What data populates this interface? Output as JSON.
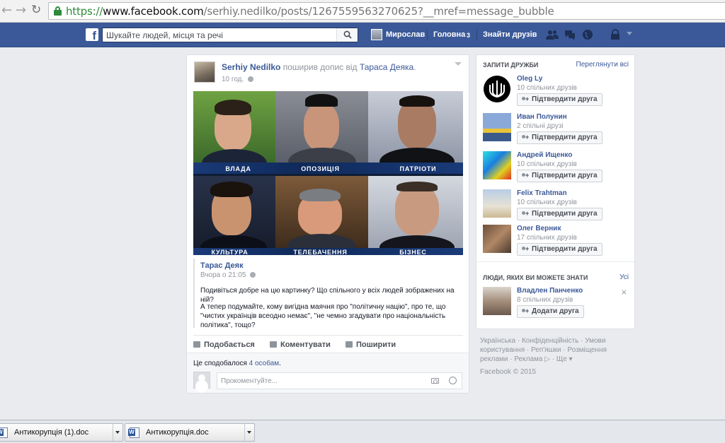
{
  "browser": {
    "url_scheme": "https://",
    "url_domain": "www.facebook.com",
    "url_path": "/serhiy.nedilko/posts/1267559563270625?__mref=message_bubble"
  },
  "topbar": {
    "logo": "f",
    "search_placeholder": "Шукайте людей, місця та речі",
    "user_name": "Мирослав",
    "home_label": "Головна",
    "home_count": "3",
    "find_friends_label": "Знайти друзів",
    "icons": [
      "friends-icon",
      "messages-icon",
      "notifications-icon",
      "privacy-icon",
      "menu-caret-icon"
    ]
  },
  "post": {
    "author": "Serhiy Nedilko",
    "verb": "поширив допис від",
    "origin": "Тараса Деяка",
    "time": "10 год.",
    "image_labels": [
      "ВЛАДА",
      "ОПОЗИЦІЯ",
      "ПАТРІОТИ",
      "КУЛЬТУРА",
      "ТЕЛЕБАЧЕННЯ",
      "БІЗНЕС"
    ],
    "shared": {
      "author": "Тарас Деяк",
      "time": "Вчора о 21:05",
      "paragraph1": "Подивіться добре на цю картинку? Що спільного у всіх людей зображених на ній?",
      "paragraph2": "А тепер подумайте, кому вигідна маячня про \"політичну націю\", про те, що \"чистих українців всеодно немає\", \"не чемно згадувати про національність політика\", тощо?"
    },
    "actions": {
      "like": "Подобається",
      "comment": "Коментувати",
      "share": "Поширити"
    },
    "likes_prefix": "Це сподобалося",
    "likes_link": "4 особам",
    "likes_suffix": ".",
    "comment_placeholder": "Прокоментуйте..."
  },
  "sidebar": {
    "requests_title": "ЗАПИТИ ДРУЖБИ",
    "requests_link": "Переглянути всі",
    "confirm_label": "Підтвердити друга",
    "requests": [
      {
        "name": "Oleg Ly",
        "mutual": "10 спільних друзів"
      },
      {
        "name": "Иван Полунин",
        "mutual": "2 спільні друзі"
      },
      {
        "name": "Андрей Ищенко",
        "mutual": "10 спільних друзів"
      },
      {
        "name": "Felix Trahtman",
        "mutual": "10 спільних друзів"
      },
      {
        "name": "Олег Верник",
        "mutual": "17 спільних друзів"
      }
    ],
    "pymk_title": "ЛЮДИ, ЯКИХ ВИ МОЖЕТЕ ЗНАТИ",
    "pymk_link": "Усі",
    "pymk": {
      "name": "Владлен Панченко",
      "mutual": "8 спільних друзів",
      "add_label": "Додати друга"
    }
  },
  "footer": {
    "line1": "Українська · Конфіденційність · Умови",
    "line2": "користування · Реп'яшки · Розміщення",
    "line3": "реклами · Реклама ▷ · Ще ▾",
    "copyright": "Facebook © 2015"
  },
  "taskbar": {
    "items": [
      "Антикорупція (1).doc",
      "Антикорупція.doc"
    ]
  },
  "colors": {
    "fb_blue": "#3b5998",
    "link": "#3b5998",
    "secure_green": "#2e8b3a"
  }
}
